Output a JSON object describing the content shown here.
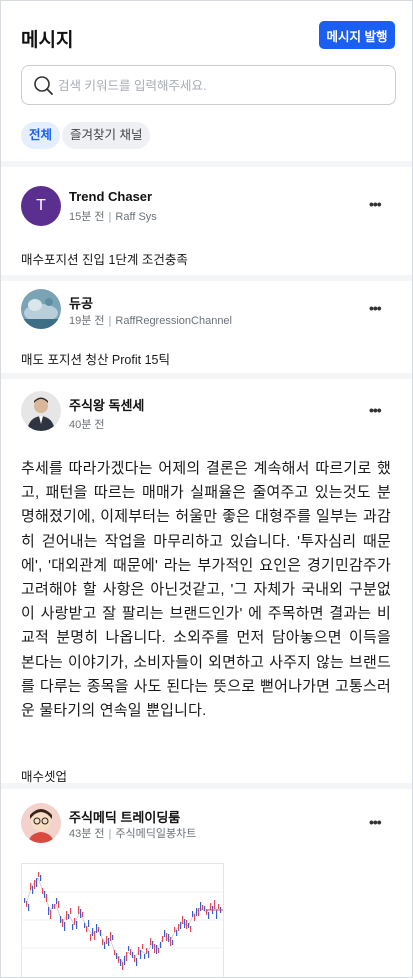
{
  "header": {
    "title": "메시지",
    "publish_label": "메시지 발행"
  },
  "search": {
    "placeholder": "검색 키워드를 입력해주세요.",
    "value": ""
  },
  "filters": [
    {
      "label": "전체",
      "active": true
    },
    {
      "label": "즐겨찾기 채널",
      "active": false
    }
  ],
  "posts": [
    {
      "channel": "Trend Chaser",
      "avatar_letter": "T",
      "time": "15분 전",
      "source": "Raff Sys",
      "body": "매수포지션 진입 1단계 조건충족"
    },
    {
      "channel": "듀공",
      "time": "19분 전",
      "source": "RaffRegressionChannel",
      "body": "매도 포지션 청산 Profit 15틱"
    },
    {
      "channel": "주식왕 독센세",
      "time": "40분 전",
      "body": "추세를 따라가겠다는 어제의 결론은 계속해서 따르기로 했고, 패턴을 따르는 매매가 실패율은 줄여주고 있는것도 분명해졌기에, 이제부터는 허울만 좋은 대형주를 일부는 과감히 걷어내는 작업을 마무리하고 있습니다. '투자심리 때문에', '대외관계 때문에' 라는 부가적인 요인은 경기민감주가 고려해야 할 사항은 아닌것같고, '그 자체가 국내외 구분없이 사랑받고 잘 팔리는 브랜드인가' 에 주목하면 결과는 비교적 분명히 나옵니다. 소외주를 먼저 담아놓으면 이득을 본다는 이야기가, 소비자들이 외면하고 사주지 않는 브랜드를 다루는 종목을 사도 된다는 뜻으로 뻗어나가면 고통스러운 물타기의 연속일 뿐입니다.",
      "tag": "매수셋업"
    },
    {
      "channel": "주식메딕 트레이딩룸",
      "time": "43분 전",
      "source": "주식메딕일봉차트",
      "thumb_watermark": "차트 이미지"
    }
  ],
  "colors": {
    "accent": "#1a5ef2",
    "avatar_trend_chaser": "#5b2f8f"
  },
  "icons": {
    "search": "search-icon",
    "more": "more-horizontal-icon"
  }
}
